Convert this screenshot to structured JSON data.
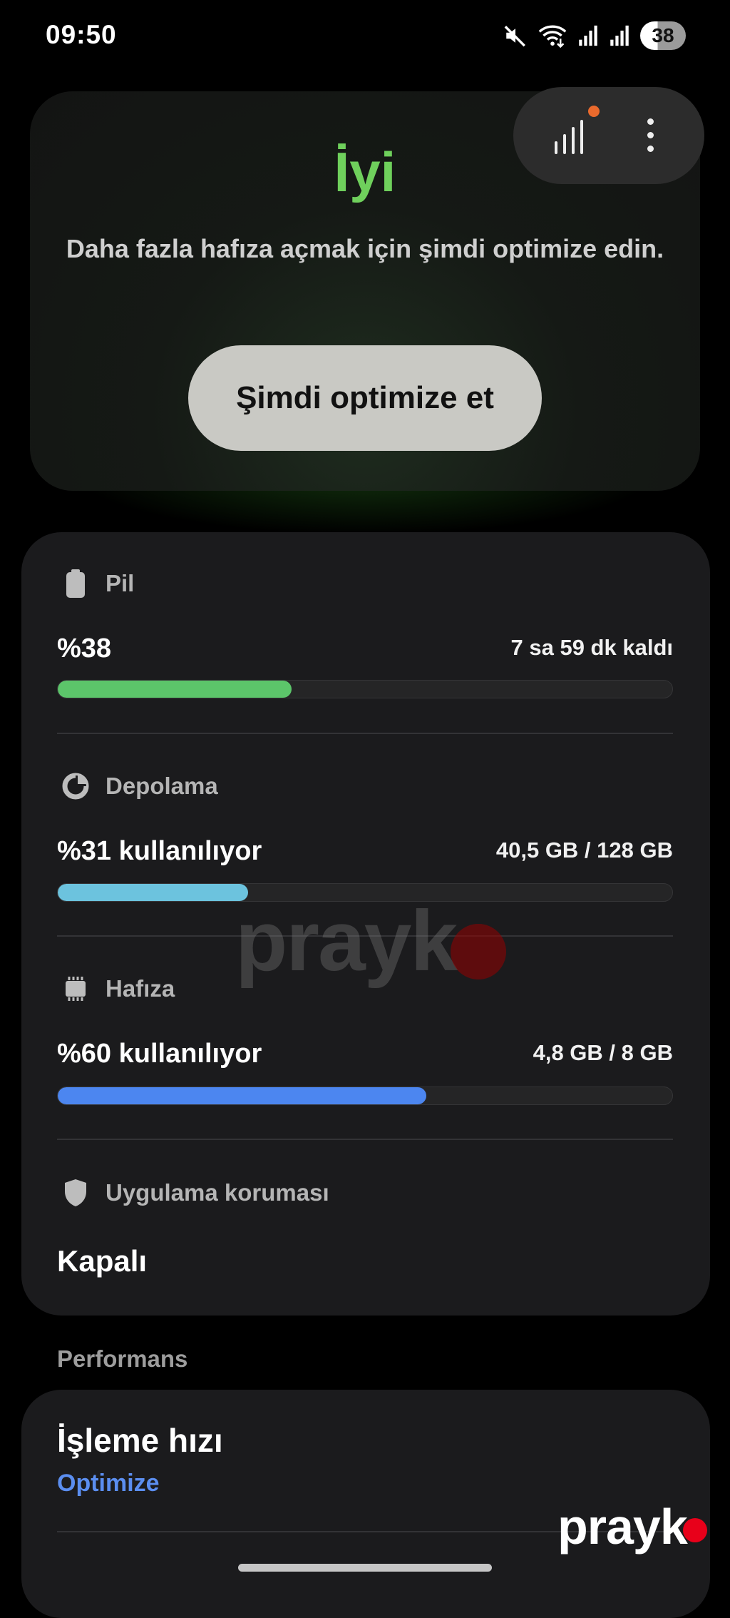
{
  "status_bar": {
    "time": "09:50",
    "battery_level": "38",
    "icons": [
      "mute-icon",
      "wifi-icon",
      "signal-icon",
      "signal-icon-2",
      "battery-icon"
    ]
  },
  "hero": {
    "status": "İyi",
    "description": "Daha fazla hafıza açmak için şimdi optimize edin.",
    "button_label": "Şimdi optimize et",
    "accent_color": "#6fd05c"
  },
  "toolbar": {
    "icons": [
      "bar-chart-icon",
      "more-vert-icon"
    ],
    "notification_dot_color": "#ea6a2d"
  },
  "stats": {
    "battery": {
      "label": "Pil",
      "value": "%38",
      "detail": "7 sa 59 dk kaldı",
      "percent": 38,
      "color": "#5cc56a"
    },
    "storage": {
      "label": "Depolama",
      "value": "%31 kullanılıyor",
      "detail": "40,5 GB / 128 GB",
      "percent": 31,
      "color": "#6cc3de"
    },
    "memory": {
      "label": "Hafıza",
      "value": "%60 kullanılıyor",
      "detail": "4,8 GB / 8 GB",
      "percent": 60,
      "color": "#4c86f0"
    },
    "app_protection": {
      "label": "Uygulama koruması",
      "value": "Kapalı"
    }
  },
  "performance": {
    "section_label": "Performans",
    "title": "İşleme hızı",
    "link": "Optimize"
  },
  "watermark": {
    "text": "prayk"
  }
}
